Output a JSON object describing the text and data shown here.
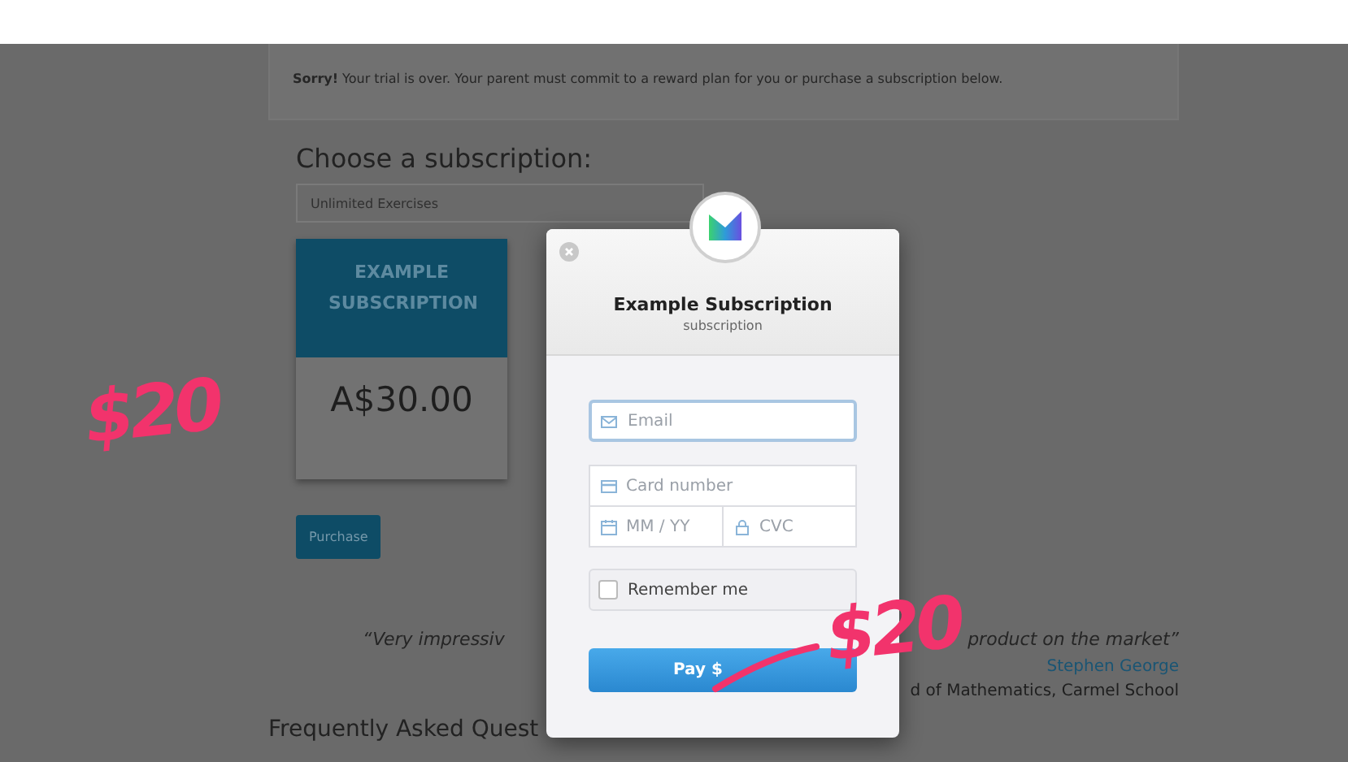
{
  "notice": "**Sorry!** Your trial is over. Your parent must commit to a reward plan for you or purchase a subscription below.",
  "heading": "Choose a subscription:",
  "plan_select": {
    "value": "Unlimited Exercises"
  },
  "plan_card": {
    "name": "EXAMPLE SUBSCRIPTION",
    "price": "A$30.00"
  },
  "purchase_button": "Purchase",
  "testimonial": {
    "quote_start": "“Very impressiv",
    "quote_end": "product on the market”",
    "author": "Stephen George",
    "role": "d of Mathematics, Carmel School"
  },
  "faq_heading": "Frequently Asked Quest",
  "checkout": {
    "title": "Example Subscription",
    "subtitle": "subscription",
    "email": {
      "placeholder": "Email"
    },
    "card_number": {
      "placeholder": "Card number"
    },
    "expiry": {
      "placeholder": "MM / YY"
    },
    "cvc": {
      "placeholder": "CVC"
    },
    "remember": {
      "label": "Remember me",
      "checked": false
    },
    "pay_button": "Pay $"
  },
  "annotations": [
    {
      "text": "$20"
    },
    {
      "text": "$20"
    }
  ]
}
